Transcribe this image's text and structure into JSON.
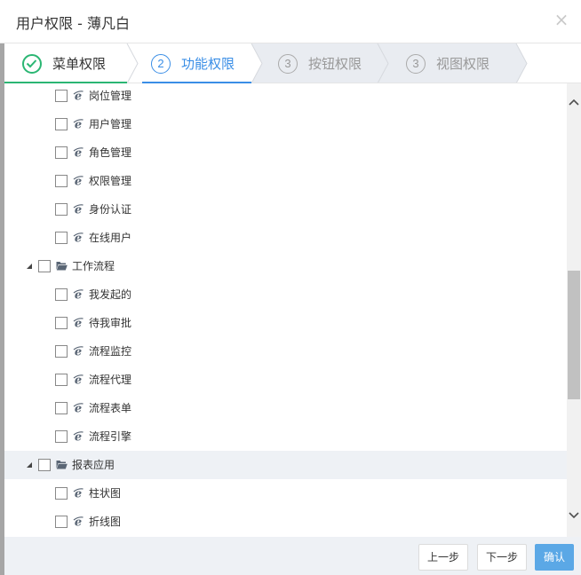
{
  "dialog": {
    "title": "用户权限 - 薄凡白",
    "close_glyph": "×"
  },
  "steps": [
    {
      "number": "",
      "label": "菜单权限",
      "state": "done"
    },
    {
      "number": "2",
      "label": "功能权限",
      "state": "active"
    },
    {
      "number": "3",
      "label": "按钮权限",
      "state": "pending"
    },
    {
      "number": "3",
      "label": "视图权限",
      "state": "pending"
    }
  ],
  "tree": {
    "items": [
      {
        "label": "岗位管理",
        "icon": "ie-page-icon",
        "checked": false
      },
      {
        "label": "用户管理",
        "icon": "ie-page-icon",
        "checked": false
      },
      {
        "label": "角色管理",
        "icon": "ie-page-icon",
        "checked": false
      },
      {
        "label": "权限管理",
        "icon": "ie-page-icon",
        "checked": false
      },
      {
        "label": "身份认证",
        "icon": "ie-page-icon",
        "checked": false
      },
      {
        "label": "在线用户",
        "icon": "ie-page-icon",
        "checked": false
      },
      {
        "label": "工作流程",
        "icon": "folder-open-icon",
        "checked": false,
        "expanded": true
      },
      {
        "label": "我发起的",
        "icon": "ie-page-icon",
        "checked": false
      },
      {
        "label": "待我审批",
        "icon": "ie-page-icon",
        "checked": false
      },
      {
        "label": "流程监控",
        "icon": "ie-page-icon",
        "checked": false
      },
      {
        "label": "流程代理",
        "icon": "ie-page-icon",
        "checked": false
      },
      {
        "label": "流程表单",
        "icon": "ie-page-icon",
        "checked": false
      },
      {
        "label": "流程引擎",
        "icon": "ie-page-icon",
        "checked": false
      },
      {
        "label": "报表应用",
        "icon": "folder-open-icon",
        "checked": false,
        "expanded": true,
        "highlighted": true
      },
      {
        "label": "柱状图",
        "icon": "ie-page-icon",
        "checked": false
      },
      {
        "label": "折线图",
        "icon": "ie-page-icon",
        "checked": false
      }
    ]
  },
  "footer": {
    "prev_label": "上一步",
    "next_label": "下一步",
    "confirm_label": "确认"
  },
  "colors": {
    "done": "#2bb673",
    "active": "#3a8ee6",
    "primary_button": "#5ba8e6"
  }
}
